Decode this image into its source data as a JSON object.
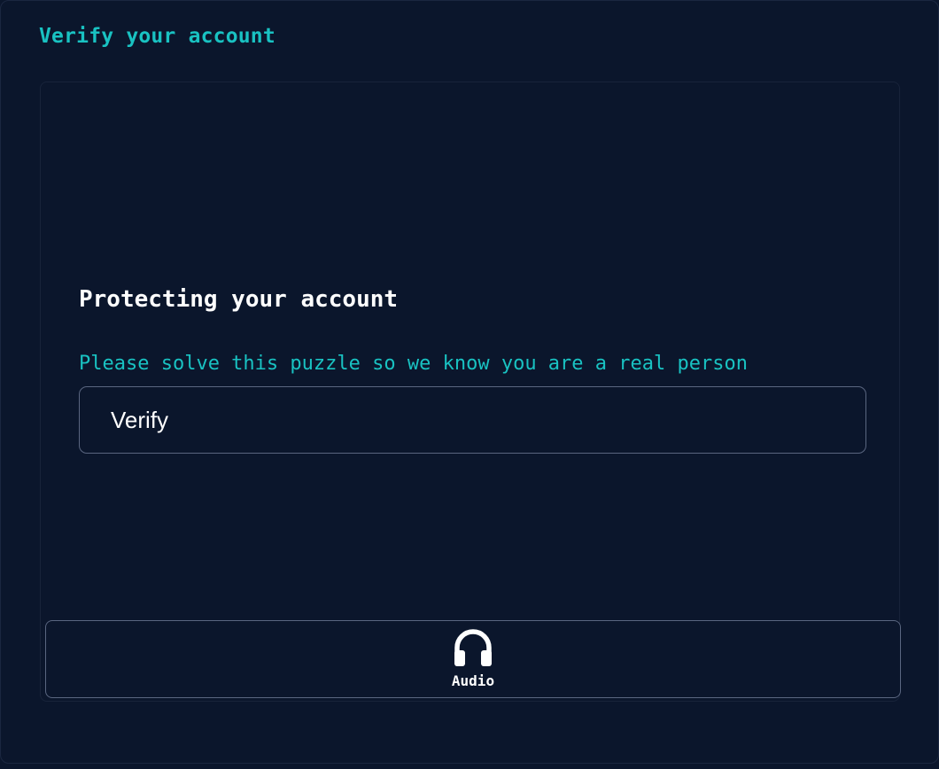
{
  "header": {
    "title": "Verify your account"
  },
  "challenge": {
    "title": "Protecting your account",
    "subtitle": "Please solve this puzzle so we know you are a real person",
    "verify_label": "Verify"
  },
  "audio": {
    "label": "Audio",
    "icon": "headphones-icon"
  },
  "colors": {
    "background": "#0b162c",
    "accent": "#19c2c2",
    "text": "#ffffff",
    "border": "#5a6680"
  }
}
